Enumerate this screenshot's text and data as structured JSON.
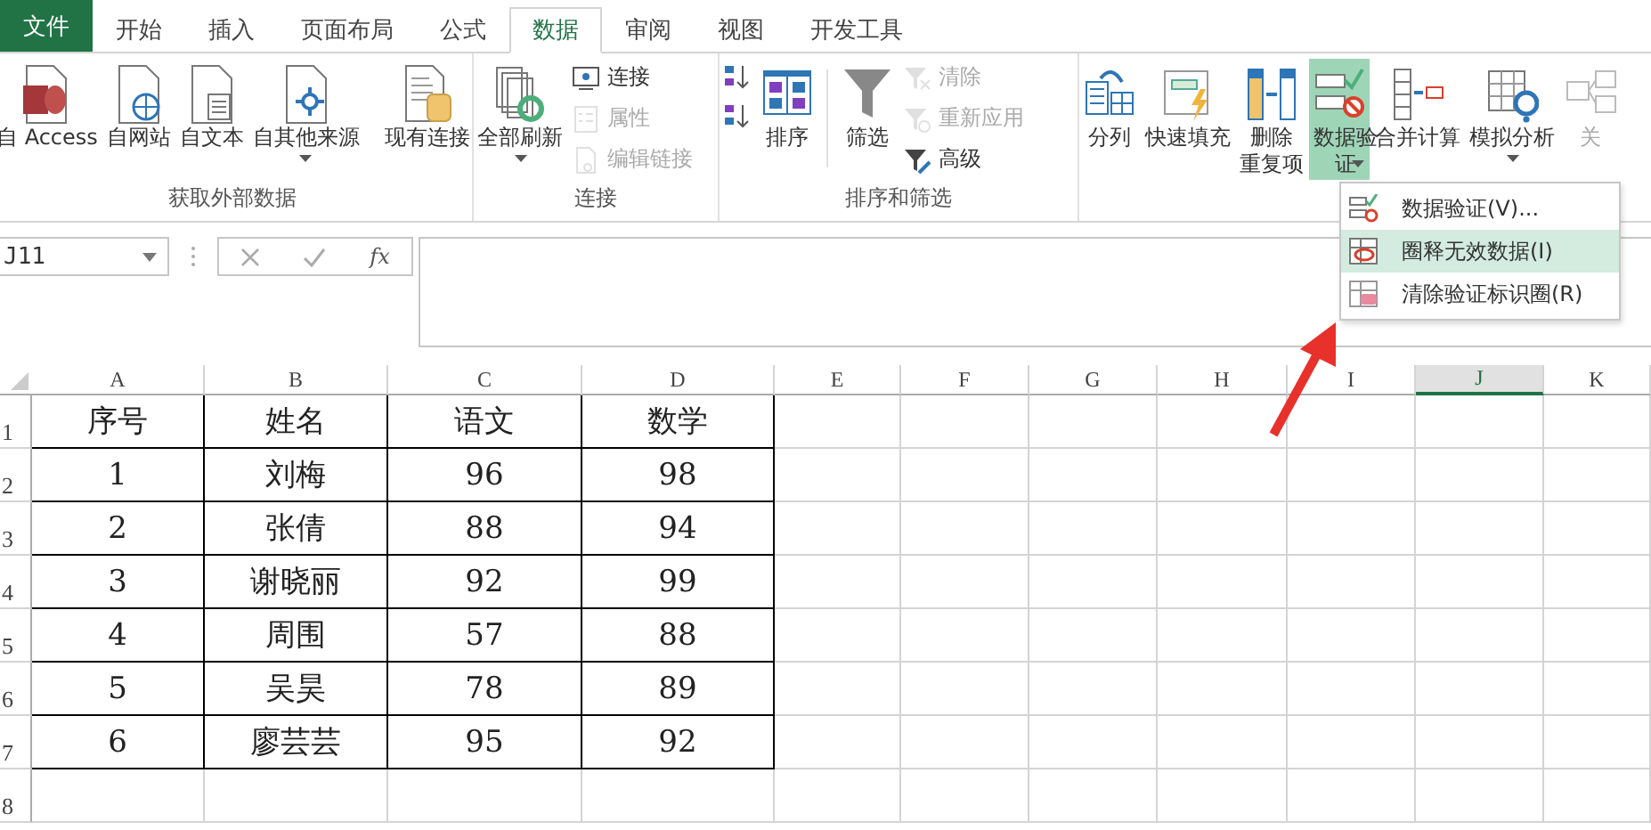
{
  "tabs": [
    {
      "label": "文件",
      "kind": "file",
      "selected": false
    },
    {
      "label": "开始",
      "kind": "tab",
      "selected": false
    },
    {
      "label": "插入",
      "kind": "tab",
      "selected": false
    },
    {
      "label": "页面布局",
      "kind": "tab",
      "selected": false
    },
    {
      "label": "公式",
      "kind": "tab",
      "selected": false
    },
    {
      "label": "数据",
      "kind": "tab",
      "selected": true
    },
    {
      "label": "审阅",
      "kind": "tab",
      "selected": false
    },
    {
      "label": "视图",
      "kind": "tab",
      "selected": false
    },
    {
      "label": "开发工具",
      "kind": "tab",
      "selected": false
    }
  ],
  "ribbon": {
    "groups": [
      {
        "label": "获取外部数据",
        "items": [
          {
            "kind": "large",
            "label": "自 Access",
            "dropdown": false,
            "selected": false
          },
          {
            "kind": "large",
            "label": "自网站",
            "dropdown": false,
            "selected": false
          },
          {
            "kind": "large",
            "label": "自文本",
            "dropdown": false,
            "selected": false
          },
          {
            "kind": "large",
            "label": "自其他来源",
            "dropdown": true,
            "selected": false
          },
          {
            "kind": "separator"
          },
          {
            "kind": "large",
            "label": "现有连接",
            "dropdown": false,
            "selected": false
          }
        ]
      },
      {
        "label": "连接",
        "items": [
          {
            "kind": "large",
            "label": "全部刷新",
            "dropdown": true,
            "selected": false
          },
          {
            "kind": "stack",
            "items": [
              {
                "label": "连接",
                "disabled": false
              },
              {
                "label": "属性",
                "disabled": true
              },
              {
                "label": "编辑链接",
                "disabled": true
              }
            ]
          }
        ]
      },
      {
        "label": "排序和筛选",
        "items": [
          {
            "kind": "stack",
            "items": [
              {
                "disabled": false
              },
              {
                "disabled": false
              }
            ]
          },
          {
            "kind": "large",
            "label": "排序",
            "dropdown": false,
            "selected": false
          },
          {
            "kind": "separator"
          },
          {
            "kind": "large",
            "label": "筛选",
            "dropdown": false,
            "selected": false
          },
          {
            "kind": "stack",
            "items": [
              {
                "label": "清除",
                "disabled": true
              },
              {
                "label": "重新应用",
                "disabled": true
              },
              {
                "label": "高级",
                "disabled": false
              }
            ]
          }
        ]
      },
      {
        "items": [
          {
            "kind": "large",
            "label": "分列",
            "dropdown": false,
            "selected": false
          },
          {
            "kind": "large",
            "label": "快速填充",
            "dropdown": false,
            "selected": false
          },
          {
            "kind": "large",
            "label": "删除重复项",
            "dropdown": false,
            "selected": false
          },
          {
            "kind": "large",
            "label": "数据验证",
            "dropdown": true,
            "selected": true
          },
          {
            "kind": "large",
            "label": "合并计算",
            "dropdown": false,
            "selected": false
          },
          {
            "kind": "large",
            "label": "模拟分析",
            "dropdown": true,
            "selected": false
          },
          {
            "kind": "large",
            "label": "关",
            "dropdown": false,
            "selected": false,
            "disabled": true
          }
        ]
      }
    ]
  },
  "dropdown_menu": {
    "items": [
      {
        "label": "数据验证(V)...",
        "selected": false
      },
      {
        "label": "圈释无效数据(I)",
        "selected": true
      },
      {
        "label": "清除验证标识圈(R)",
        "selected": false
      }
    ]
  },
  "formula_bar": {
    "name_box": "J11",
    "function_label": "fx"
  },
  "sheet": {
    "columns": [
      {
        "label": "A",
        "selected": false
      },
      {
        "label": "B",
        "selected": false
      },
      {
        "label": "C",
        "selected": false
      },
      {
        "label": "D",
        "selected": false
      },
      {
        "label": "E",
        "selected": false
      },
      {
        "label": "F",
        "selected": false
      },
      {
        "label": "G",
        "selected": false
      },
      {
        "label": "H",
        "selected": false
      },
      {
        "label": "I",
        "selected": false
      },
      {
        "label": "J",
        "selected": true
      },
      {
        "label": "K",
        "selected": false
      }
    ],
    "rows": [
      {
        "number": "1",
        "cells": [
          "序号",
          "姓名",
          "语文",
          "数学"
        ]
      },
      {
        "number": "2",
        "cells": [
          "1",
          "刘梅",
          "96",
          "98"
        ]
      },
      {
        "number": "3",
        "cells": [
          "2",
          "张倩",
          "88",
          "94"
        ]
      },
      {
        "number": "4",
        "cells": [
          "3",
          "谢晓丽",
          "92",
          "99"
        ]
      },
      {
        "number": "5",
        "cells": [
          "4",
          "周围",
          "57",
          "88"
        ]
      },
      {
        "number": "6",
        "cells": [
          "5",
          "吴昊",
          "78",
          "89"
        ]
      },
      {
        "number": "7",
        "cells": [
          "6",
          "廖芸芸",
          "95",
          "92"
        ]
      },
      {
        "number": "8",
        "cells": []
      }
    ]
  }
}
